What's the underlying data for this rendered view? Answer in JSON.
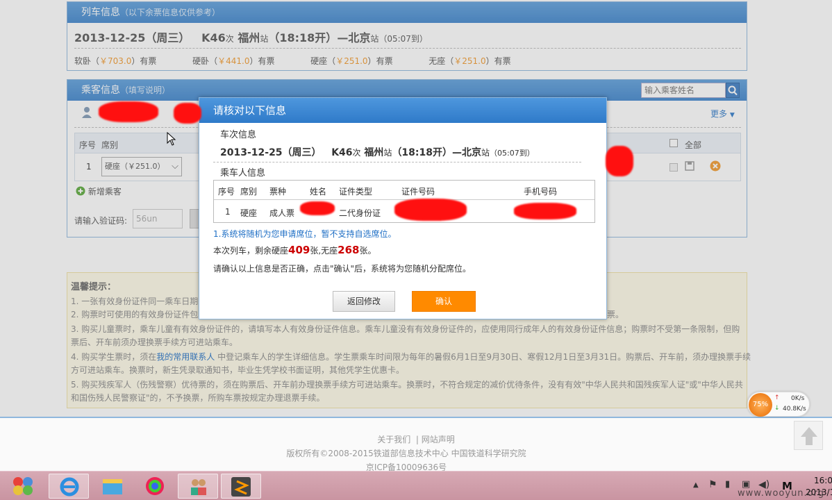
{
  "train_panel": {
    "title": "列车信息",
    "subtitle": "（以下余票信息仅供参考）",
    "date": "2013-12-25（周三）",
    "train_no": "K46",
    "train_suffix": "次",
    "from": "福州",
    "station_suffix": "站",
    "depart": "（18:18开）",
    "dash": "—",
    "to": "北京",
    "to_suffix": "站",
    "arrive": "（05:07到）",
    "seats": [
      {
        "name": "软卧",
        "price": "￥703.0",
        "status": "有票"
      },
      {
        "name": "硬卧",
        "price": "￥441.0",
        "status": "有票"
      },
      {
        "name": "硬座",
        "price": "￥251.0",
        "status": "有票"
      },
      {
        "name": "无座",
        "price": "￥251.0",
        "status": "有票"
      }
    ]
  },
  "passenger_panel": {
    "title": "乘客信息",
    "subtitle": "（填写说明）",
    "search_placeholder": "输入乘客姓名",
    "more_label": "更多",
    "col_seq": "序号",
    "col_seat": "席别",
    "col_all": "全部",
    "row_seq": "1",
    "row_seat_select": "硬座（￥251.0）",
    "add_passenger": "新增乘客",
    "captcha_label": "请输入验证码:",
    "captcha_value": "56un"
  },
  "tips": {
    "title": "温馨提示：",
    "lines": [
      "1. 一张有效身份证件同一乘车日期",
      "2. 购票时可使用的有效身份证件包",
      "3. 购买儿童票时，乘车儿童有有效身份证件的，请填写本人有效身份证件信息。乘车儿童没有有效身份证件的，应使用同行成年人的有效身份证件信息；购票时不受第一条限制，但购",
      "票后、开车前须办理换票手续方可进站乘车。",
      "4. 购买学生票时，须在",
      "我的常用联系人",
      "中登记乘车人的学生详细信息。学生票乘车时间限为每年的暑假6月1日至9月30日、寒假12月1日至3月31日。购票后、开车前，须办理换票手续",
      "方可进站乘车。换票时，新生凭录取通知书，毕业生凭学校书面证明，其他凭学生优惠卡。",
      "5. 购买残疾军人（伤残警察）优待票的，须在购票后、开车前办理换票手续方可进站乘车。换票时，不符合规定的减价优待条件，没有有效\"中华人民共和国残疾军人证\"或\"中华人民共",
      "和国伤残人民警察证\"的，不予换票，所购车票按规定办理退票手续。"
    ],
    "line2_tail": "票。"
  },
  "footer": {
    "about": "关于我们",
    "sep": "|",
    "statement": "网站声明",
    "copyright": "版权所有©2008-2015铁道部信息技术中心   中国铁道科学研究院",
    "icp": "京ICP备10009636号"
  },
  "modal": {
    "title": "请核对以下信息",
    "train_section": "车次信息",
    "date": "2013-12-25（周三）",
    "train_no": "K46",
    "train_suffix": "次",
    "from": "福州",
    "station_suffix": "站",
    "depart": "（18:18开）",
    "dash": "—",
    "to": "北京",
    "to_suffix": "站",
    "arrive": "（05:07到）",
    "passenger_section": "乘车人信息",
    "table_headers": [
      "序号",
      "席别",
      "票种",
      "姓名",
      "证件类型",
      "证件号码",
      "手机号码"
    ],
    "row": {
      "seq": "1",
      "seat": "硬座",
      "ticket_type": "成人票",
      "id_type": "二代身份证"
    },
    "note": "1.系统将随机为您申请席位，暂不支持自选席位。",
    "remain_prefix": "本次列车，剩余硬座",
    "remain_hard": "409",
    "remain_mid": "张,无座",
    "remain_none": "268",
    "remain_suffix": "张。",
    "confirm_text": "请确认以上信息是否正确，点击\"确认\"后，系统将为您随机分配席位。",
    "back_button": "返回修改",
    "confirm_button": "确认"
  },
  "net_widget": {
    "percent": "75%",
    "up": "0K/s",
    "down": "40.8K/s"
  },
  "taskbar": {
    "ime": "M",
    "time": "16:0",
    "date": "2013/1",
    "watermark": "www.wooyun.org"
  }
}
